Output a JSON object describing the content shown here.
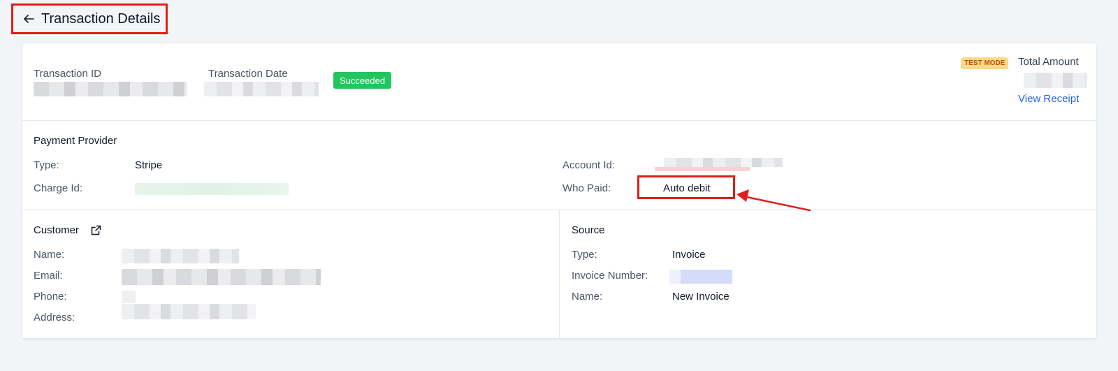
{
  "header": {
    "title": "Transaction Details"
  },
  "summary": {
    "transaction_id_label": "Transaction ID",
    "transaction_date_label": "Transaction Date",
    "status": "Succeeded",
    "test_mode_badge": "TEST MODE",
    "total_amount_label": "Total Amount",
    "view_receipt": "View Receipt"
  },
  "payment_provider": {
    "title": "Payment Provider",
    "type_label": "Type:",
    "type_value": "Stripe",
    "charge_id_label": "Charge Id:",
    "account_id_label": "Account Id:",
    "who_paid_label": "Who Paid:",
    "who_paid_value": "Auto debit"
  },
  "customer": {
    "title": "Customer",
    "name_label": "Name:",
    "email_label": "Email:",
    "phone_label": "Phone:",
    "address_label": "Address:"
  },
  "source": {
    "title": "Source",
    "type_label": "Type:",
    "type_value": "Invoice",
    "invoice_number_label": "Invoice Number:",
    "name_label": "Name:",
    "name_value": "New Invoice"
  },
  "colors": {
    "status_green": "#22c55e",
    "link_blue": "#2563eb",
    "annotation_red": "#e01e1e",
    "test_mode_bg": "#fcd98b"
  },
  "icons": {
    "back": "arrow-left-icon",
    "customer_link": "external-link-icon"
  }
}
